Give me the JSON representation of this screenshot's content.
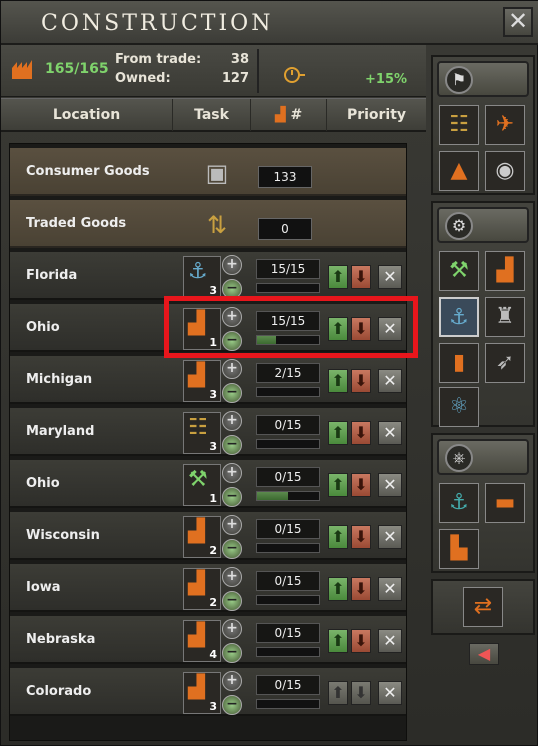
{
  "window": {
    "title": "Construction",
    "close_glyph": "✕"
  },
  "stats": {
    "factory_count": "165/165",
    "from_trade_label": "From trade:",
    "from_trade_value": "38",
    "owned_label": "Owned:",
    "owned_value": "127",
    "speed_bonus": "+15%"
  },
  "headers": {
    "location": "Location",
    "task": "Task",
    "count": "#",
    "priority": "Priority"
  },
  "goods": [
    {
      "name": "Consumer Goods",
      "value": "133",
      "icon": "consumer-goods-icon"
    },
    {
      "name": "Traded Goods",
      "value": "0",
      "icon": "traded-goods-icon"
    }
  ],
  "rows": [
    {
      "location": "Florida",
      "building": "dockyard-icon",
      "level": "3",
      "progress_text": "15/15",
      "progress": 0.0,
      "up_enabled": true,
      "down_enabled": true
    },
    {
      "location": "Ohio",
      "building": "civilian-factory-icon",
      "level": "1",
      "progress_text": "15/15",
      "progress": 0.3,
      "up_enabled": true,
      "down_enabled": true
    },
    {
      "location": "Michigan",
      "building": "civilian-factory-icon",
      "level": "3",
      "progress_text": "2/15",
      "progress": 0.0,
      "up_enabled": true,
      "down_enabled": true
    },
    {
      "location": "Maryland",
      "building": "railway-icon",
      "level": "3",
      "progress_text": "0/15",
      "progress": 0.0,
      "up_enabled": true,
      "down_enabled": true
    },
    {
      "location": "Ohio",
      "building": "military-factory-icon",
      "level": "1",
      "progress_text": "0/15",
      "progress": 0.5,
      "up_enabled": true,
      "down_enabled": true
    },
    {
      "location": "Wisconsin",
      "building": "civilian-factory-icon",
      "level": "2",
      "progress_text": "0/15",
      "progress": 0.0,
      "up_enabled": true,
      "down_enabled": true
    },
    {
      "location": "Iowa",
      "building": "civilian-factory-icon",
      "level": "2",
      "progress_text": "0/15",
      "progress": 0.0,
      "up_enabled": true,
      "down_enabled": true
    },
    {
      "location": "Nebraska",
      "building": "civilian-factory-icon",
      "level": "4",
      "progress_text": "0/15",
      "progress": 0.0,
      "up_enabled": true,
      "down_enabled": true
    },
    {
      "location": "Colorado",
      "building": "civilian-factory-icon",
      "level": "3",
      "progress_text": "0/15",
      "progress": 0.0,
      "up_enabled": false,
      "down_enabled": false
    }
  ],
  "sidebar": {
    "group1": [
      "flag-build-icon",
      "railway-icon",
      "airport-icon",
      "anti-air-icon",
      "radar-icon"
    ],
    "group2": [
      "industry-header-icon",
      "military-factory-icon",
      "civilian-factory-icon",
      "dockyard-icon",
      "synthetic-refinery-icon",
      "fuel-silo-icon",
      "rocket-site-icon",
      "nuclear-reactor-icon"
    ],
    "group3": [
      "naval-header-icon",
      "naval-base-icon",
      "bunker-icon",
      "coastal-fort-icon"
    ],
    "group4": [
      "trade-icon"
    ]
  },
  "colors": {
    "highlight": "#e8161c",
    "positive": "#7fd36c"
  }
}
